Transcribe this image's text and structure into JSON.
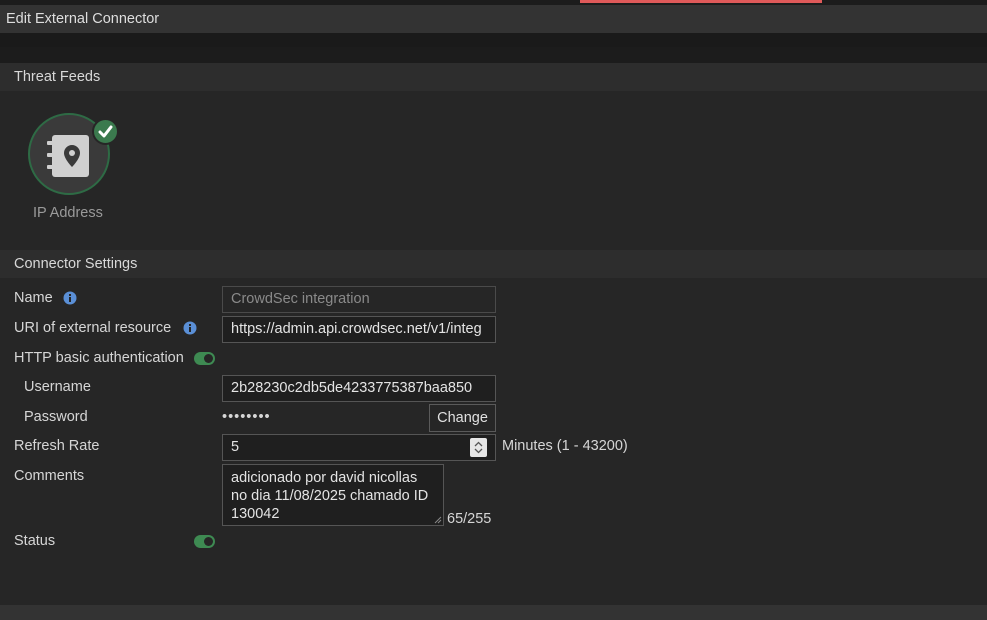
{
  "window": {
    "title": "Edit External Connector"
  },
  "colors": {
    "accent": "#e05a5a",
    "success": "#3e8a52"
  },
  "threat_feeds": {
    "heading": "Threat Feeds",
    "items": [
      {
        "label": "IP Address",
        "icon": "address-book-pin-icon",
        "selected": true
      }
    ]
  },
  "settings": {
    "heading": "Connector Settings",
    "name_label": "Name",
    "name_placeholder": "CrowdSec integration",
    "uri_label": "URI of external resource",
    "uri_value": "https://admin.api.crowdsec.net/v1/integ",
    "http_auth_label": "HTTP basic authentication",
    "http_auth_enabled": true,
    "username_label": "Username",
    "username_value": "2b28230c2db5de4233775387baa850",
    "password_label": "Password",
    "password_mask": "••••••••",
    "change_button": "Change",
    "refresh_label": "Refresh Rate",
    "refresh_value": "5",
    "refresh_unit": "Minutes (1 - 43200)",
    "comments_label": "Comments",
    "comments_value": "adicionado por david nicollas no dia 11/08/2025 chamado ID 130042",
    "comments_count": "65/255",
    "status_label": "Status",
    "status_enabled": true
  }
}
